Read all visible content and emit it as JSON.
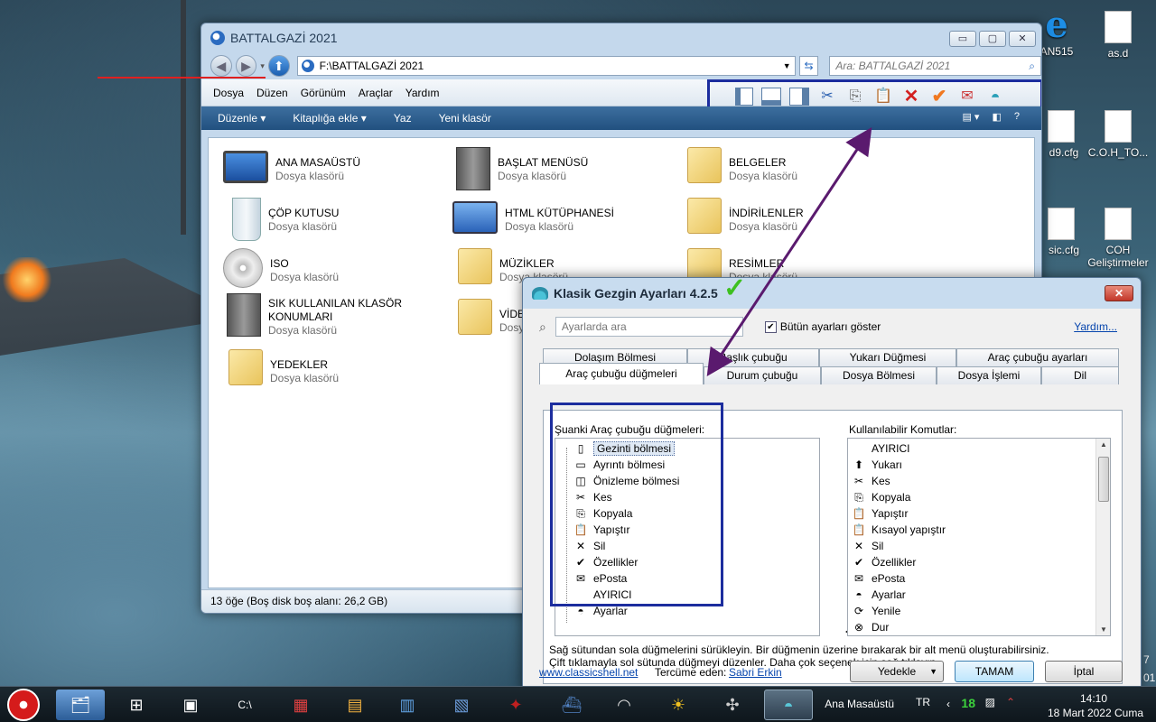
{
  "desktop": {
    "icons": [
      {
        "label": "AN515",
        "icon": "ie-icon"
      },
      {
        "label": "as.d",
        "icon": "file-icon"
      },
      {
        "label": "d9.cfg",
        "icon": "file-icon"
      },
      {
        "label": "C.O.H_TO...",
        "icon": "shortcut-file-icon"
      },
      {
        "label": "sic.cfg",
        "icon": "file-icon"
      },
      {
        "label": "COH Geliştirmeler",
        "icon": "shortcut-file-icon"
      }
    ],
    "edge_text": [
      "7",
      "01"
    ]
  },
  "explorer": {
    "title": "BATTALGAZİ 2021",
    "address": "F:\\BATTALGAZİ 2021",
    "search_placeholder": "Ara: BATTALGAZİ 2021",
    "caption": {
      "min": "▭",
      "max": "▢",
      "close": "✕"
    },
    "menu": [
      "Dosya",
      "Düzen",
      "Görünüm",
      "Araçlar",
      "Yardım"
    ],
    "toolbar_icons": [
      "navigation-pane-icon",
      "details-pane-icon",
      "preview-pane-icon",
      "cut-icon",
      "copy-icon",
      "paste-icon",
      "delete-icon",
      "properties-icon",
      "email-icon",
      "settings-shell-icon"
    ],
    "commands": [
      "Düzenle ▾",
      "Kitaplığa ekle ▾",
      "Yaz",
      "Yeni klasör"
    ],
    "items": [
      {
        "name": "ANA MASAÜSTÜ",
        "type": "Dosya klasörü",
        "icon": "monitor"
      },
      {
        "name": "BAŞLAT MENÜSÜ",
        "type": "Dosya klasörü",
        "icon": "server"
      },
      {
        "name": "BELGELER",
        "type": "Dosya klasörü",
        "icon": "folder"
      },
      {
        "name": "ÇÖP KUTUSU",
        "type": "Dosya klasörü",
        "icon": "bin"
      },
      {
        "name": "HTML KÜTÜPHANESİ",
        "type": "Dosya klasörü",
        "icon": "net"
      },
      {
        "name": "İNDİRİLENLER",
        "type": "Dosya klasörü",
        "icon": "folder"
      },
      {
        "name": "ISO",
        "type": "Dosya klasörü",
        "icon": "disc"
      },
      {
        "name": "MÜZİKLER",
        "type": "Dosya klasörü",
        "icon": "folder"
      },
      {
        "name": "RESİMLER",
        "type": "Dosya klasörü",
        "icon": "folder"
      },
      {
        "name": "SIK KULLANILAN KLASÖR KONUMLARI",
        "type": "Dosya klasörü",
        "icon": "server"
      },
      {
        "name": "VİDE",
        "type": "Dosy",
        "icon": "folder"
      },
      {
        "name": "YEDEKLER",
        "type": "Dosya klasörü",
        "icon": "folder"
      }
    ],
    "status": "13 öğe (Boş disk boş alanı: 26,2 GB)"
  },
  "dialog": {
    "title": "Klasik Gezgin Ayarları 4.2.5",
    "search_placeholder": "Ayarlarda ara",
    "show_all_label": "Bütün ayarları göster",
    "show_all_checked": true,
    "help": "Yardım...",
    "tabs_back": [
      "Dolaşım Bölmesi",
      "Başlık çubuğu",
      "Yukarı Düğmesi",
      "Araç çubuğu ayarları"
    ],
    "tabs_front": [
      "Araç çubuğu düğmeleri",
      "Durum çubuğu",
      "Dosya Bölmesi",
      "Dosya İşlemi",
      "Dil"
    ],
    "current_label": "Şuanki Araç çubuğu düğmeleri:",
    "current_items": [
      {
        "label": "Gezinti bölmesi",
        "icon": "▯"
      },
      {
        "label": "Ayrıntı bölmesi",
        "icon": "▭"
      },
      {
        "label": "Önizleme bölmesi",
        "icon": "◫"
      },
      {
        "label": "Kes",
        "icon": "✂"
      },
      {
        "label": "Kopyala",
        "icon": "⎘"
      },
      {
        "label": "Yapıştır",
        "icon": "📋"
      },
      {
        "label": "Sil",
        "icon": "✕"
      },
      {
        "label": "Özellikler",
        "icon": "✔"
      },
      {
        "label": "ePosta",
        "icon": "✉"
      },
      {
        "label": "AYIRICI",
        "icon": ""
      },
      {
        "label": "Ayarlar",
        "icon": "◓"
      }
    ],
    "move_label": "<<",
    "available_label": "Kullanılabilir Komutlar:",
    "available_items": [
      {
        "label": "AYIRICI",
        "icon": ""
      },
      {
        "label": "Yukarı",
        "icon": "⬆"
      },
      {
        "label": "Kes",
        "icon": "✂"
      },
      {
        "label": "Kopyala",
        "icon": "⎘"
      },
      {
        "label": "Yapıştır",
        "icon": "📋"
      },
      {
        "label": "Kısayol yapıştır",
        "icon": "📋"
      },
      {
        "label": "Sil",
        "icon": "✕"
      },
      {
        "label": "Özellikler",
        "icon": "✔"
      },
      {
        "label": "ePosta",
        "icon": "✉"
      },
      {
        "label": "Ayarlar",
        "icon": "◓"
      },
      {
        "label": "Yenile",
        "icon": "⟳"
      },
      {
        "label": "Dur",
        "icon": "⊗"
      }
    ],
    "desc1": "Sağ sütundan sola düğmelerini sürükleyin. Bir düğmenin üzerine bırakarak bir alt menü oluşturabilirsiniz.",
    "desc2": "Çift tıklamayla sol sütunda düğmeyi düzenler. Daha çok seçenek için sağ tıklayın.",
    "website": "www.classicshell.net",
    "translator_label": "Tercüme eden:",
    "translator": "Sabri Erkin",
    "backup_btn": "Yedekle",
    "ok_btn": "TAMAM",
    "cancel_btn": "İptal"
  },
  "taskbar": {
    "desktop_label": "Ana Masaüstü",
    "lang": "TR",
    "badge": "18",
    "time": "14:10",
    "date": "18 Mart 2022 Cuma"
  },
  "colors": {
    "annotation_blue": "#1c2d9e",
    "annotation_red": "#e02020",
    "arrow_purple": "#5a1a6e"
  }
}
